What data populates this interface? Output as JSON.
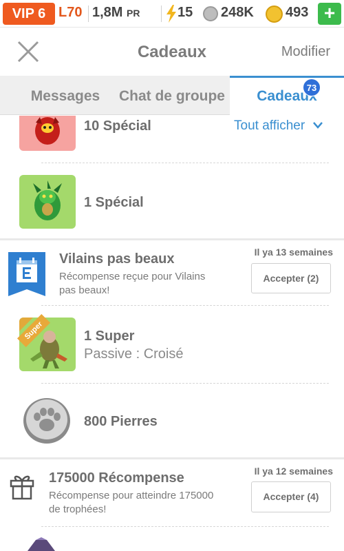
{
  "status_bar": {
    "vip": "VIP 6",
    "level": "L70",
    "power": "1,8M",
    "power_unit": "PR",
    "energy": "15",
    "stones": "248K",
    "coins": "493",
    "add_label": "+",
    "icons": [
      "lightning-icon",
      "paw-stone-icon",
      "gold-coin-icon",
      "plus-icon"
    ],
    "colors": {
      "vip": "#ef5a1f",
      "add": "#3cbb4c"
    }
  },
  "header": {
    "close_icon": "close-icon",
    "title": "Cadeaux",
    "modify": "Modifier"
  },
  "tabs": {
    "items": [
      {
        "label": "Messages",
        "active": false
      },
      {
        "label": "Chat de groupe",
        "active": false
      },
      {
        "label": "Cadeaux",
        "active": true
      }
    ],
    "badge": "73",
    "accent": "#3a8fd0"
  },
  "gifts": {
    "group1": {
      "items": [
        {
          "title": "10 Spécial",
          "icon": "red-monster-icon"
        },
        {
          "title": "1 Spécial",
          "icon": "green-monster-icon"
        }
      ],
      "show_all": "Tout afficher"
    },
    "group2": {
      "icon": "event-calendar-icon",
      "title": "Vilains pas beaux",
      "time": "Il ya 13 semaines",
      "description_line1": "Récompense reçue pour Vilains",
      "description_line2": "pas beaux!",
      "accept": "Accepter (2)",
      "items": [
        {
          "title": "1 Super",
          "subtitle": "Passive : Croisé",
          "ribbon": "Super",
          "icon": "super-monster-icon"
        },
        {
          "title": "800 Pierres",
          "icon": "paw-stone-icon"
        }
      ]
    },
    "group3": {
      "icon": "gift-box-icon",
      "title": "175000 Récompense",
      "time": "Il ya 12 semaines",
      "description_line1": "Récompense pour atteindre 175000",
      "description_line2": "de trophées!",
      "accept": "Accepter (4)"
    }
  }
}
